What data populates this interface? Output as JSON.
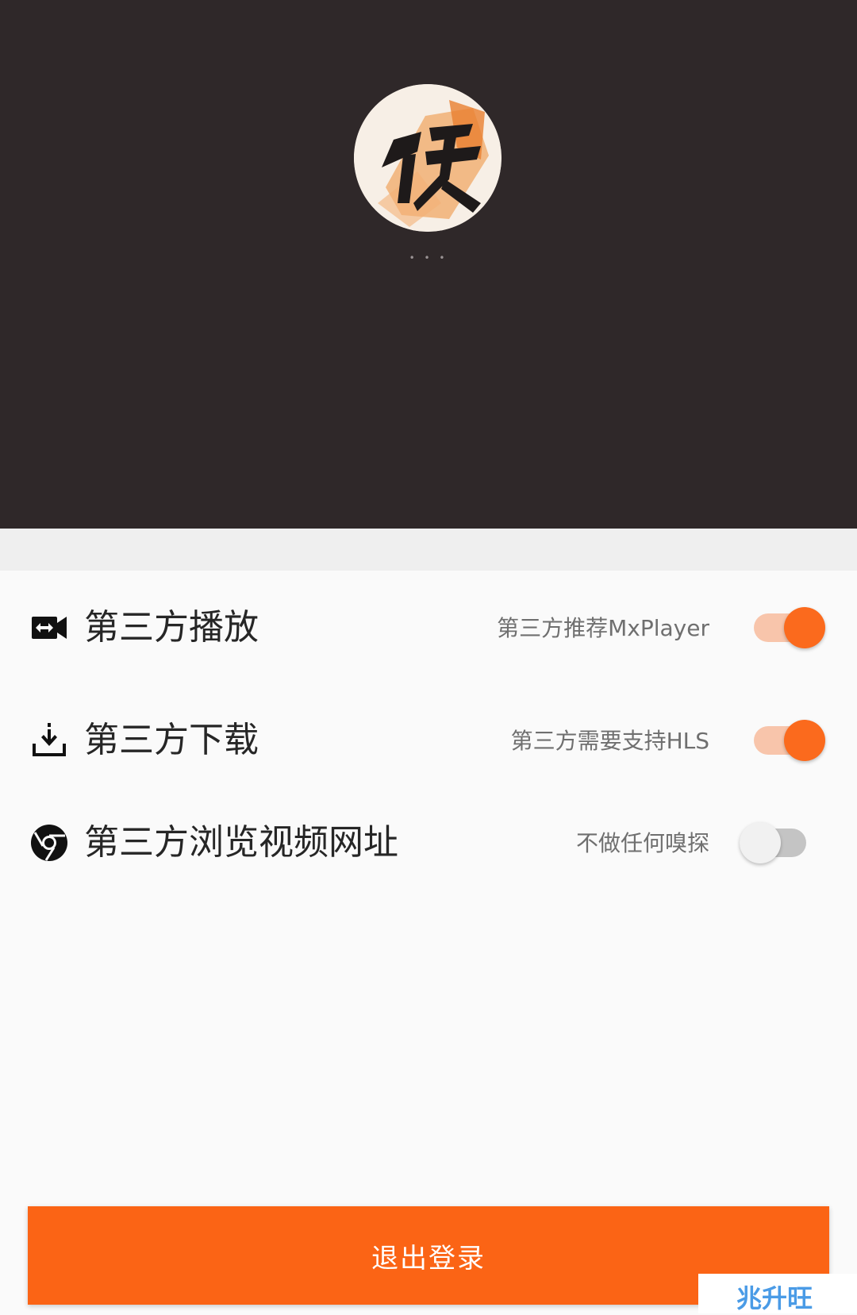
{
  "profile": {
    "username": "• • •"
  },
  "settings": [
    {
      "icon": "video-switch-icon",
      "label": "第三方播放",
      "hint": "第三方推荐MxPlayer",
      "enabled": true
    },
    {
      "icon": "download-icon",
      "label": "第三方下载",
      "hint": "第三方需要支持HLS",
      "enabled": true
    },
    {
      "icon": "chrome-icon",
      "label": "第三方浏览视频网址",
      "hint": "不做任何嗅探",
      "enabled": false
    }
  ],
  "logout": {
    "label": "退出登录"
  },
  "watermark": {
    "text": "兆升旺"
  },
  "colors": {
    "header_bg": "#2f2829",
    "accent": "#fb6415",
    "switch_on_knob": "#fb6a1d",
    "switch_on_track": "#f8c5ab",
    "switch_off_track": "#c4c4c4"
  }
}
